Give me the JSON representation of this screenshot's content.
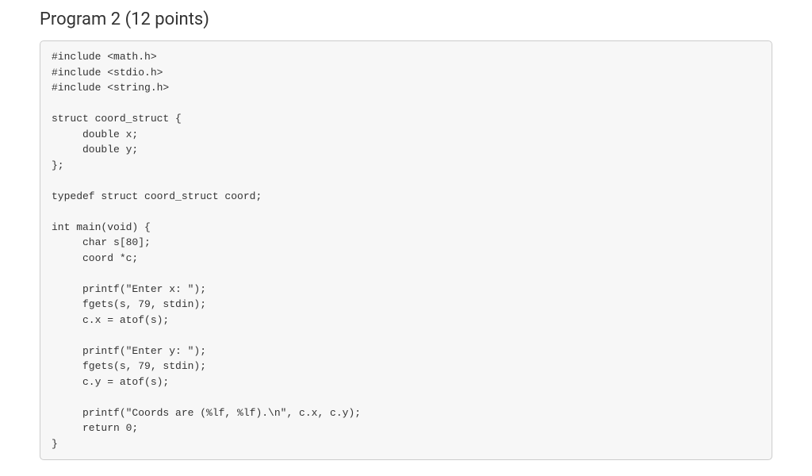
{
  "heading": "Program 2 (12 points)",
  "code": "#include <math.h>\n#include <stdio.h>\n#include <string.h>\n\nstruct coord_struct {\n     double x;\n     double y;\n};\n\ntypedef struct coord_struct coord;\n\nint main(void) {\n     char s[80];\n     coord *c;\n\n     printf(\"Enter x: \");\n     fgets(s, 79, stdin);\n     c.x = atof(s);\n\n     printf(\"Enter y: \");\n     fgets(s, 79, stdin);\n     c.y = atof(s);\n\n     printf(\"Coords are (%lf, %lf).\\n\", c.x, c.y);\n     return 0;\n}"
}
